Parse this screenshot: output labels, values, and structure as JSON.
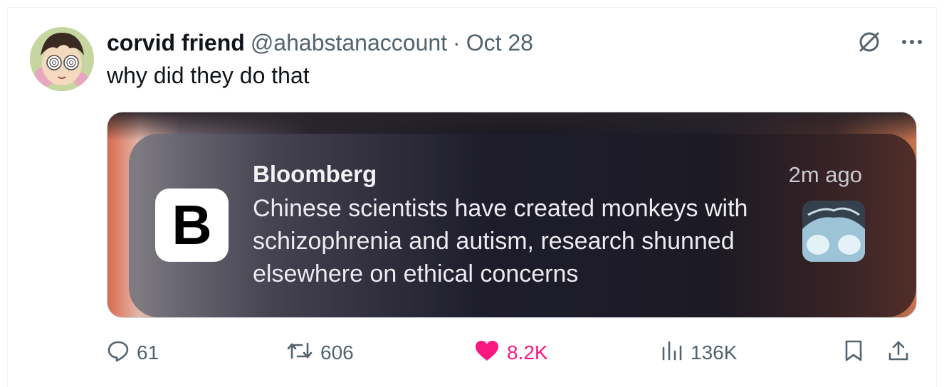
{
  "tweet": {
    "author": {
      "display_name": "corvid friend",
      "handle": "@ahabstanaccount",
      "separator": "·",
      "date": "Oct 28"
    },
    "text": "why did they do that",
    "media": {
      "notification": {
        "app_icon_letter": "B",
        "source": "Bloomberg",
        "time": "2m ago",
        "body": "Chinese scientists have created monkeys with schizophrenia and autism, research shunned elsewhere on ethical concerns"
      }
    },
    "metrics": {
      "replies": "61",
      "reposts": "606",
      "likes": "8.2K",
      "views": "136K"
    },
    "icons": {
      "grok": "grok-icon",
      "more": "more-icon",
      "reply": "reply-icon",
      "repost": "repost-icon",
      "like": "heart-icon",
      "views": "views-icon",
      "bookmark": "bookmark-icon",
      "share": "share-icon"
    },
    "colors": {
      "like_active": "#f91880",
      "secondary_text": "#536471",
      "primary_text": "#0f1419"
    }
  }
}
